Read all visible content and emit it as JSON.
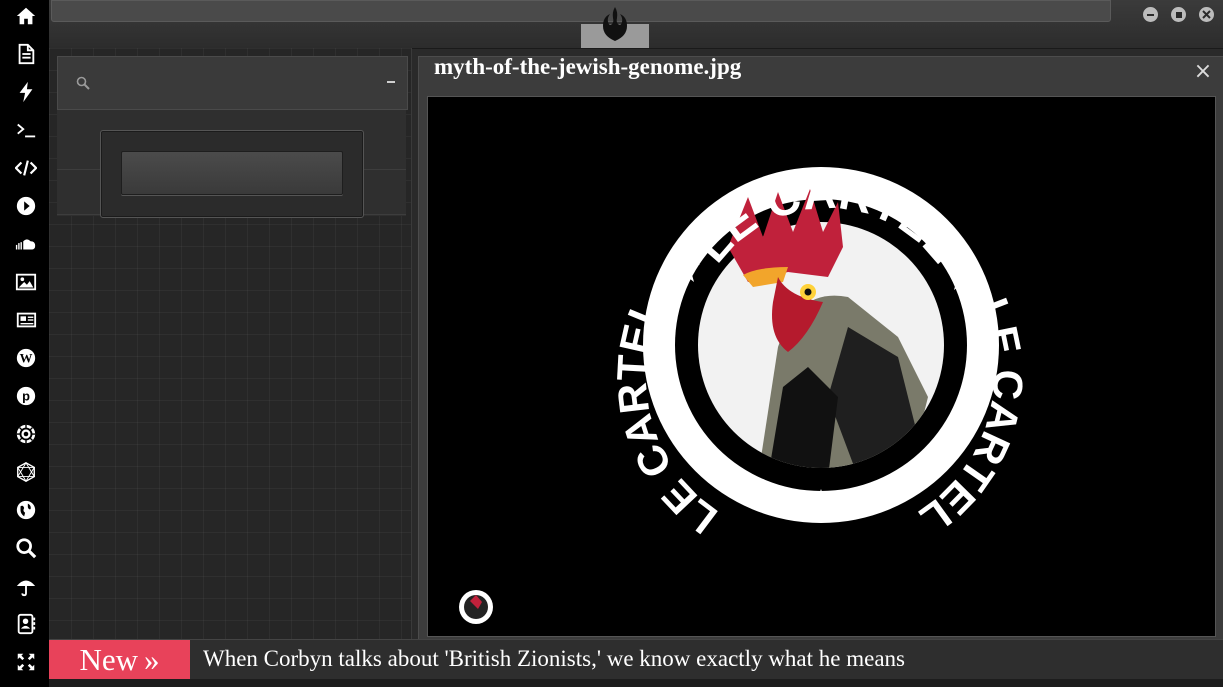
{
  "colors": {
    "sidebar_bg": "#000000",
    "accent_badge": "#e8425a",
    "panel_bg": "#262626",
    "viewer_bg": "#3c3c3c"
  },
  "sidebar": {
    "items": [
      {
        "icon": "home-icon"
      },
      {
        "icon": "document-icon"
      },
      {
        "icon": "lightning-icon"
      },
      {
        "icon": "terminal-icon"
      },
      {
        "icon": "code-icon"
      },
      {
        "icon": "play-circle-icon"
      },
      {
        "icon": "soundcloud-icon"
      },
      {
        "icon": "image-icon"
      },
      {
        "icon": "newspaper-icon"
      },
      {
        "icon": "wordpress-icon"
      },
      {
        "icon": "pinterest-icon"
      },
      {
        "icon": "galactic-empire-icon"
      },
      {
        "icon": "network-icon"
      },
      {
        "icon": "globe-icon"
      },
      {
        "icon": "search-icon"
      },
      {
        "icon": "umbrella-icon"
      },
      {
        "icon": "contacts-icon"
      },
      {
        "icon": "fullscreen-icon"
      }
    ]
  },
  "topbar": {
    "logo_icon": "rebel-alliance-icon",
    "window_buttons": [
      "minimize-icon",
      "maximize-icon",
      "close-icon"
    ]
  },
  "left_panel": {
    "search_placeholder": "",
    "search_icon": "search-icon"
  },
  "viewer": {
    "title": "myth-of-the-jewish-genome.jpg",
    "close_label": "×",
    "image_text_top": "LE CARTEL",
    "image_text_left": "LE CARTEL",
    "image_text_right": "LE CARTEL"
  },
  "ticker": {
    "badge_label": "New",
    "badge_arrow": "»",
    "headline": "When Corbyn talks about 'British Zionists,' we know exactly what he means"
  }
}
